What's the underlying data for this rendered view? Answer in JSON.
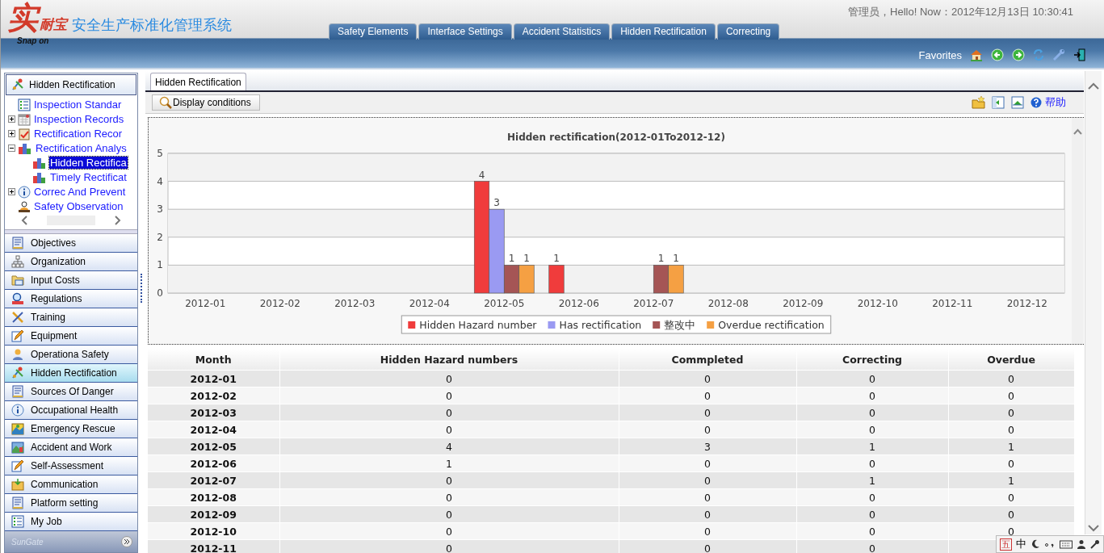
{
  "header": {
    "logo": {
      "mark": "实",
      "brand": "耐宝",
      "system": "安全生产标准化管理系统",
      "tagline": "Snap on"
    },
    "greeting": "管理员，Hello! Now：2012年12月13日  10:30:41",
    "tabs": [
      {
        "label": "Safety Elements",
        "selected": false
      },
      {
        "label": "Interface Settings",
        "selected": false
      },
      {
        "label": "Accident Statistics",
        "selected": false
      },
      {
        "label": "Hidden Rectification",
        "selected": false
      },
      {
        "label": "Correcting",
        "selected": false
      }
    ],
    "favorites": "Favorites"
  },
  "sidebar": {
    "title": "Hidden Rectification",
    "tree": [
      {
        "label": "Inspection Standar",
        "selected": false
      },
      {
        "label": "Inspection Records",
        "expanded": false,
        "selected": false
      },
      {
        "label": "Rectification Recor",
        "expanded": false,
        "selected": false
      },
      {
        "label": "Rectification Analys",
        "expanded": true,
        "selected": false,
        "children": [
          {
            "label": "Hidden Rectifica",
            "selected": true
          },
          {
            "label": "Timely Rectificat",
            "selected": false
          }
        ]
      },
      {
        "label": "Correc And Prevent",
        "expanded": false,
        "selected": false
      },
      {
        "label": "Safety Observation",
        "selected": false
      }
    ],
    "nav": [
      {
        "label": "Objectives",
        "selected": false
      },
      {
        "label": "Organization",
        "selected": false
      },
      {
        "label": "Input Costs",
        "selected": false
      },
      {
        "label": "Regulations",
        "selected": false
      },
      {
        "label": "Training",
        "selected": false
      },
      {
        "label": "Equipment",
        "selected": false
      },
      {
        "label": "Operationa Safety",
        "selected": false
      },
      {
        "label": "Hidden Rectification",
        "selected": true
      },
      {
        "label": "Sources Of Danger",
        "selected": false
      },
      {
        "label": "Occupational Health",
        "selected": false
      },
      {
        "label": "Emergency Rescue",
        "selected": false
      },
      {
        "label": "Accident and Work",
        "selected": false
      },
      {
        "label": "Self-Assessment",
        "selected": false
      },
      {
        "label": "Communication",
        "selected": false
      },
      {
        "label": "Platform setting",
        "selected": false
      },
      {
        "label": "My Job",
        "selected": false
      }
    ],
    "footer": "SunGate"
  },
  "content": {
    "tabs": [
      {
        "label": "Hidden Rectification",
        "selected": true
      }
    ],
    "display_button": "Display conditions",
    "help": "帮助",
    "chart_data": {
      "type": "bar",
      "title": "Hidden rectification(2012-01To2012-12)",
      "categories": [
        "2012-01",
        "2012-02",
        "2012-03",
        "2012-04",
        "2012-05",
        "2012-06",
        "2012-07",
        "2012-08",
        "2012-09",
        "2012-10",
        "2012-11",
        "2012-12"
      ],
      "series": [
        {
          "name": "Hidden Hazard number",
          "color": "#f03c3c",
          "values": [
            0,
            0,
            0,
            0,
            4,
            1,
            0,
            0,
            0,
            0,
            0,
            0
          ]
        },
        {
          "name": "Has rectification",
          "color": "#9a9af2",
          "values": [
            0,
            0,
            0,
            0,
            3,
            0,
            0,
            0,
            0,
            0,
            0,
            0
          ]
        },
        {
          "name": "整改中",
          "color": "#a55555",
          "values": [
            0,
            0,
            0,
            0,
            1,
            0,
            1,
            0,
            0,
            0,
            0,
            0
          ]
        },
        {
          "name": "Overdue rectification",
          "color": "#f5a043",
          "values": [
            0,
            0,
            0,
            0,
            1,
            0,
            1,
            0,
            0,
            0,
            0,
            0
          ]
        }
      ],
      "ylim": [
        0,
        5
      ],
      "yticks": [
        0,
        1,
        2,
        3,
        4,
        5
      ],
      "grid": true,
      "legend": true,
      "value_labels": [
        [
          null,
          null,
          null,
          null,
          "4",
          "1",
          null,
          null,
          null,
          null,
          null,
          null
        ],
        [
          null,
          null,
          null,
          null,
          "3",
          null,
          null,
          null,
          null,
          null,
          null,
          null
        ],
        [
          null,
          null,
          null,
          null,
          "1",
          null,
          "1",
          null,
          null,
          null,
          null,
          null
        ],
        [
          null,
          null,
          null,
          null,
          "1",
          null,
          "1",
          null,
          null,
          null,
          null,
          null
        ]
      ]
    },
    "table": {
      "columns": [
        "Month",
        "Hidden Hazard numbers",
        "Commpleted",
        "Correcting",
        "Overdue"
      ],
      "rows": [
        [
          "2012-01",
          "0",
          "0",
          "0",
          "0"
        ],
        [
          "2012-02",
          "0",
          "0",
          "0",
          "0"
        ],
        [
          "2012-03",
          "0",
          "0",
          "0",
          "0"
        ],
        [
          "2012-04",
          "0",
          "0",
          "0",
          "0"
        ],
        [
          "2012-05",
          "4",
          "3",
          "1",
          "1"
        ],
        [
          "2012-06",
          "1",
          "0",
          "0",
          "0"
        ],
        [
          "2012-07",
          "0",
          "0",
          "1",
          "1"
        ],
        [
          "2012-08",
          "0",
          "0",
          "0",
          "0"
        ],
        [
          "2012-09",
          "0",
          "0",
          "0",
          "0"
        ],
        [
          "2012-10",
          "0",
          "0",
          "0",
          "0"
        ],
        [
          "2012-11",
          "0",
          "0",
          "0"
        ]
      ]
    }
  },
  "ime_bar": {
    "labels": [
      "五",
      "中"
    ]
  }
}
